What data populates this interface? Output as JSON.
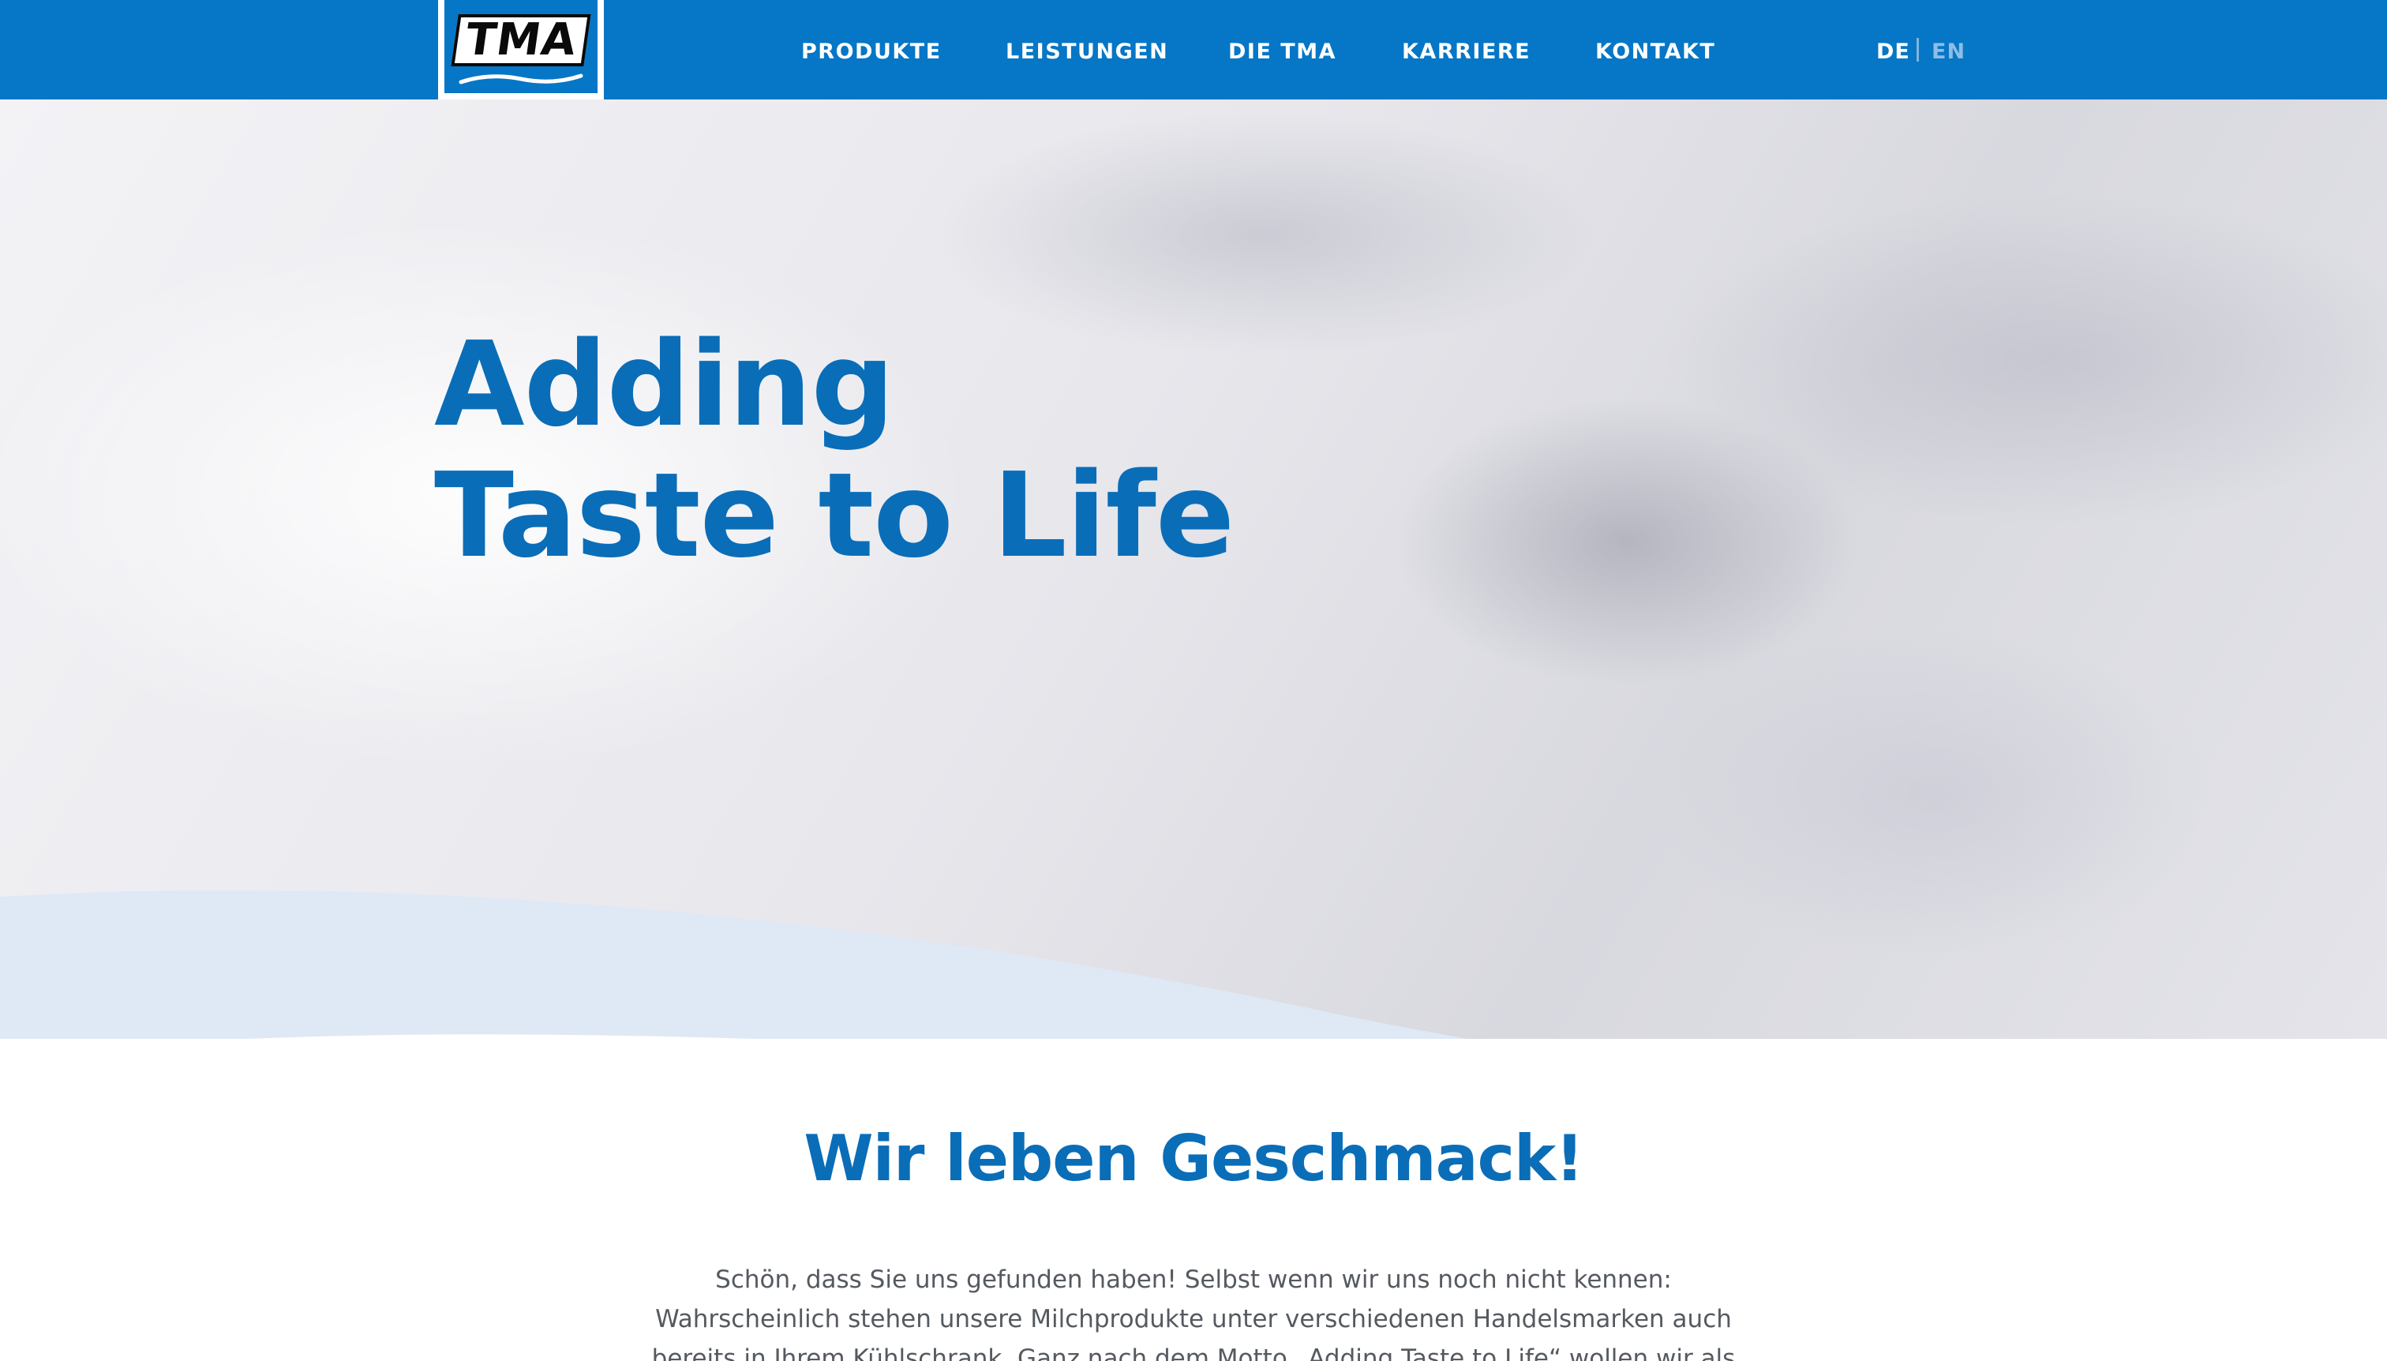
{
  "header": {
    "logo_text": "TMA",
    "nav": [
      {
        "label": "PRODUKTE"
      },
      {
        "label": "LEISTUNGEN"
      },
      {
        "label": "DIE TMA"
      },
      {
        "label": "KARRIERE"
      },
      {
        "label": "KONTAKT"
      }
    ],
    "lang": {
      "de": "DE",
      "en": "EN",
      "active": "DE"
    }
  },
  "hero": {
    "title_line1": "Adding",
    "title_line2": "Taste to Life"
  },
  "intro": {
    "heading": "Wir leben Geschmack!",
    "text": "Schön, dass Sie uns gefunden haben! Selbst wenn wir uns noch nicht kennen: Wahrscheinlich stehen unsere Milchprodukte unter verschiedenen Handelsmarken auch bereits in Ihrem Kühlschrank. Ganz nach dem Motto „Adding Taste to Life“ wollen wir als TMA dem Leben"
  },
  "colors": {
    "brand_blue": "#0676c6",
    "heading_blue": "#0a6db8",
    "body_text": "#555a60"
  }
}
